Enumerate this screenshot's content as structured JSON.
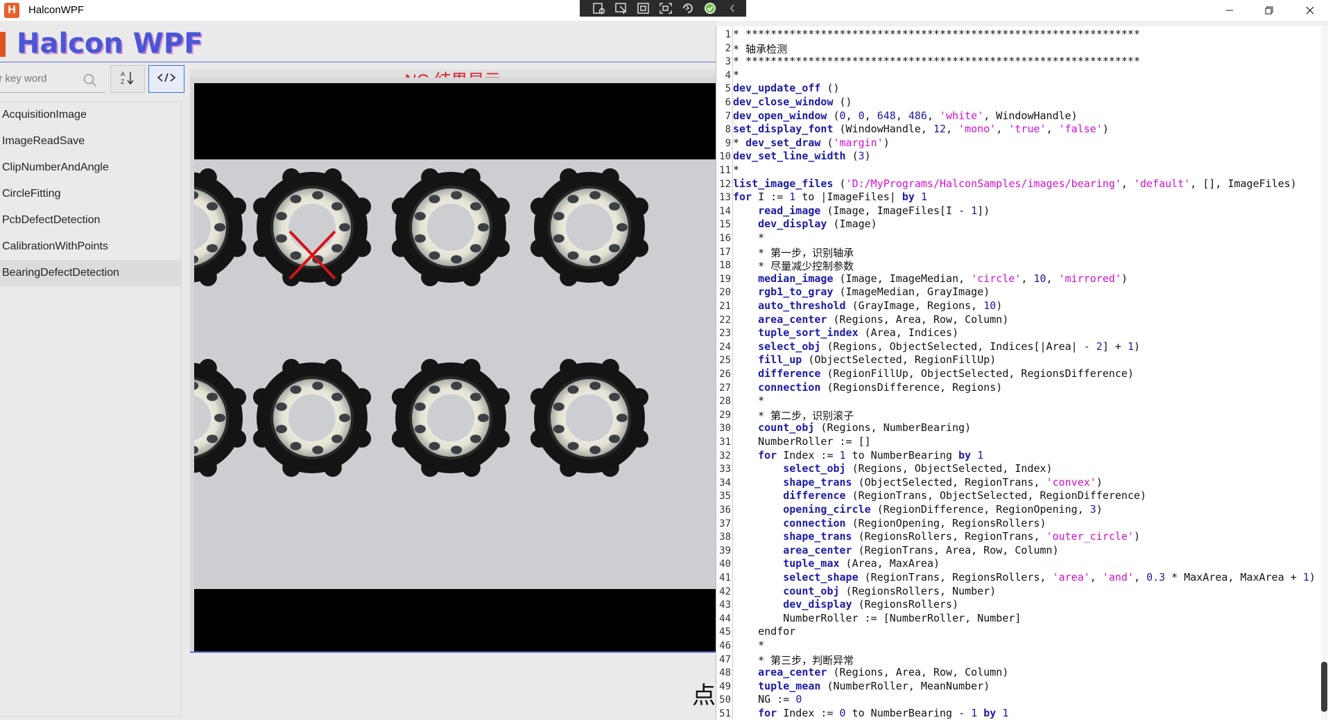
{
  "window": {
    "title": "HalconWPF",
    "app_icon_letter": "H",
    "controls": [
      "minimize-icon",
      "restore-icon",
      "close-icon"
    ]
  },
  "debug_toolbar": {
    "icons": [
      "visual-tree-icon",
      "select-element-icon",
      "display-layout-icon",
      "track-focus-icon",
      "hot-reload-icon",
      "checkmark-icon",
      "collapse-icon"
    ],
    "accent": "#6cc24a"
  },
  "header": {
    "logo": "Halcon WPF",
    "logo_color": "#4a55d6"
  },
  "search": {
    "placeholder": "er key word"
  },
  "toolbar": {
    "sort_icon": "sort-az-icon",
    "code_icon": "code-icon"
  },
  "sidebar": {
    "items": [
      {
        "label": "AcquisitionImage",
        "selected": false
      },
      {
        "label": "ImageReadSave",
        "selected": false
      },
      {
        "label": "ClipNumberAndAngle",
        "selected": false
      },
      {
        "label": "CircleFitting",
        "selected": false
      },
      {
        "label": "PcbDefectDetection",
        "selected": false
      },
      {
        "label": "CalibrationWithPoints",
        "selected": false
      },
      {
        "label": "BearingDefectDetection",
        "selected": true
      }
    ]
  },
  "result": {
    "title": "NG 结果显示",
    "title_color": "#d6202b",
    "defect_marker": "red-x-icon",
    "truncated_label": "点"
  },
  "editor": {
    "lines": [
      {
        "n": "1",
        "t": [
          [
            "* ***************************************************************",
            ""
          ]
        ]
      },
      {
        "n": "2",
        "t": [
          [
            "* 轴承检测",
            ""
          ]
        ]
      },
      {
        "n": "3",
        "t": [
          [
            "* ***************************************************************",
            ""
          ]
        ]
      },
      {
        "n": "4",
        "t": [
          [
            "*",
            ""
          ]
        ]
      },
      {
        "n": "5",
        "t": [
          [
            "dev_update_off",
            "kw"
          ],
          [
            " ()",
            ""
          ]
        ]
      },
      {
        "n": "6",
        "t": [
          [
            "dev_close_window",
            "kw"
          ],
          [
            " ()",
            ""
          ]
        ]
      },
      {
        "n": "7",
        "t": [
          [
            "dev_open_window",
            "kw"
          ],
          [
            " (",
            ""
          ],
          [
            "0",
            "num"
          ],
          [
            ", ",
            ""
          ],
          [
            "0",
            "num"
          ],
          [
            ", ",
            ""
          ],
          [
            "648",
            "num"
          ],
          [
            ", ",
            ""
          ],
          [
            "486",
            "num"
          ],
          [
            ", ",
            ""
          ],
          [
            "'white'",
            "str"
          ],
          [
            ", WindowHandle)",
            ""
          ]
        ]
      },
      {
        "n": "8",
        "t": [
          [
            "set_display_font",
            "kw"
          ],
          [
            " (WindowHandle, ",
            ""
          ],
          [
            "12",
            "num"
          ],
          [
            ", ",
            ""
          ],
          [
            "'mono'",
            "str"
          ],
          [
            ", ",
            ""
          ],
          [
            "'true'",
            "str"
          ],
          [
            ", ",
            ""
          ],
          [
            "'false'",
            "str"
          ],
          [
            ")",
            ""
          ]
        ]
      },
      {
        "n": "9",
        "t": [
          [
            "* ",
            ""
          ],
          [
            "dev_set_draw",
            "kw"
          ],
          [
            " (",
            ""
          ],
          [
            "'margin'",
            "str"
          ],
          [
            ")",
            ""
          ]
        ]
      },
      {
        "n": "10",
        "t": [
          [
            "dev_set_line_width",
            "kw"
          ],
          [
            " (",
            ""
          ],
          [
            "3",
            "num"
          ],
          [
            ")",
            ""
          ]
        ]
      },
      {
        "n": "11",
        "t": [
          [
            "*",
            ""
          ]
        ]
      },
      {
        "n": "12",
        "t": [
          [
            "list_image_files",
            "kw"
          ],
          [
            " (",
            ""
          ],
          [
            "'D:/MyPrograms/HalconSamples/images/bearing'",
            "str"
          ],
          [
            ", ",
            ""
          ],
          [
            "'default'",
            "str"
          ],
          [
            ", [], ImageFiles)",
            ""
          ]
        ]
      },
      {
        "n": "13",
        "t": [
          [
            "for",
            "ctl"
          ],
          [
            " I := ",
            ""
          ],
          [
            "1",
            "num"
          ],
          [
            " to |ImageFiles| ",
            ""
          ],
          [
            "by",
            "ctl"
          ],
          [
            " ",
            ""
          ],
          [
            "1",
            "num"
          ]
        ]
      },
      {
        "n": "14",
        "t": [
          [
            "    ",
            ""
          ],
          [
            "read_image",
            "kw"
          ],
          [
            " (Image, ImageFiles[I - ",
            ""
          ],
          [
            "1",
            "num"
          ],
          [
            "])",
            ""
          ]
        ]
      },
      {
        "n": "15",
        "t": [
          [
            "    ",
            ""
          ],
          [
            "dev_display",
            "kw"
          ],
          [
            " (Image)",
            ""
          ]
        ]
      },
      {
        "n": "16",
        "t": [
          [
            "    *",
            ""
          ]
        ]
      },
      {
        "n": "17",
        "t": [
          [
            "    * 第一步，识别轴承",
            ""
          ]
        ]
      },
      {
        "n": "18",
        "t": [
          [
            "    * 尽量减少控制参数",
            ""
          ]
        ]
      },
      {
        "n": "19",
        "t": [
          [
            "    ",
            ""
          ],
          [
            "median_image",
            "kw"
          ],
          [
            " (Image, ImageMedian, ",
            ""
          ],
          [
            "'circle'",
            "str"
          ],
          [
            ", ",
            ""
          ],
          [
            "10",
            "num"
          ],
          [
            ", ",
            ""
          ],
          [
            "'mirrored'",
            "str"
          ],
          [
            ")",
            ""
          ]
        ]
      },
      {
        "n": "20",
        "t": [
          [
            "    ",
            ""
          ],
          [
            "rgb1_to_gray",
            "kw"
          ],
          [
            " (ImageMedian, GrayImage)",
            ""
          ]
        ]
      },
      {
        "n": "21",
        "t": [
          [
            "    ",
            ""
          ],
          [
            "auto_threshold",
            "kw"
          ],
          [
            " (GrayImage, Regions, ",
            ""
          ],
          [
            "10",
            "num"
          ],
          [
            ")",
            ""
          ]
        ]
      },
      {
        "n": "22",
        "t": [
          [
            "    ",
            ""
          ],
          [
            "area_center",
            "kw"
          ],
          [
            " (Regions, Area, Row, Column)",
            ""
          ]
        ]
      },
      {
        "n": "23",
        "t": [
          [
            "    ",
            ""
          ],
          [
            "tuple_sort_index",
            "kw"
          ],
          [
            " (Area, Indices)",
            ""
          ]
        ]
      },
      {
        "n": "24",
        "t": [
          [
            "    ",
            ""
          ],
          [
            "select_obj",
            "kw"
          ],
          [
            " (Regions, ObjectSelected, Indices[|Area| - ",
            ""
          ],
          [
            "2",
            "num"
          ],
          [
            "] + ",
            ""
          ],
          [
            "1",
            "num"
          ],
          [
            ")",
            ""
          ]
        ]
      },
      {
        "n": "25",
        "t": [
          [
            "    ",
            ""
          ],
          [
            "fill_up",
            "kw"
          ],
          [
            " (ObjectSelected, RegionFillUp)",
            ""
          ]
        ]
      },
      {
        "n": "26",
        "t": [
          [
            "    ",
            ""
          ],
          [
            "difference",
            "kw"
          ],
          [
            " (RegionFillUp, ObjectSelected, RegionsDifference)",
            ""
          ]
        ]
      },
      {
        "n": "27",
        "t": [
          [
            "    ",
            ""
          ],
          [
            "connection",
            "kw"
          ],
          [
            " (RegionsDifference, Regions)",
            ""
          ]
        ]
      },
      {
        "n": "28",
        "t": [
          [
            "    *",
            ""
          ]
        ]
      },
      {
        "n": "29",
        "t": [
          [
            "    * 第二步，识别滚子",
            ""
          ]
        ]
      },
      {
        "n": "30",
        "t": [
          [
            "    ",
            ""
          ],
          [
            "count_obj",
            "kw"
          ],
          [
            " (Regions, NumberBearing)",
            ""
          ]
        ]
      },
      {
        "n": "31",
        "t": [
          [
            "    NumberRoller := []",
            ""
          ]
        ]
      },
      {
        "n": "32",
        "t": [
          [
            "    ",
            ""
          ],
          [
            "for",
            "ctl"
          ],
          [
            " Index := ",
            ""
          ],
          [
            "1",
            "num"
          ],
          [
            " to NumberBearing ",
            ""
          ],
          [
            "by",
            "ctl"
          ],
          [
            " ",
            ""
          ],
          [
            "1",
            "num"
          ]
        ]
      },
      {
        "n": "33",
        "t": [
          [
            "        ",
            ""
          ],
          [
            "select_obj",
            "kw"
          ],
          [
            " (Regions, ObjectSelected, Index)",
            ""
          ]
        ]
      },
      {
        "n": "34",
        "t": [
          [
            "        ",
            ""
          ],
          [
            "shape_trans",
            "kw"
          ],
          [
            " (ObjectSelected, RegionTrans, ",
            ""
          ],
          [
            "'convex'",
            "str"
          ],
          [
            ")",
            ""
          ]
        ]
      },
      {
        "n": "35",
        "t": [
          [
            "        ",
            ""
          ],
          [
            "difference",
            "kw"
          ],
          [
            " (RegionTrans, ObjectSelected, RegionDifference)",
            ""
          ]
        ]
      },
      {
        "n": "36",
        "t": [
          [
            "        ",
            ""
          ],
          [
            "opening_circle",
            "kw"
          ],
          [
            " (RegionDifference, RegionOpening, ",
            ""
          ],
          [
            "3",
            "num"
          ],
          [
            ")",
            ""
          ]
        ]
      },
      {
        "n": "37",
        "t": [
          [
            "        ",
            ""
          ],
          [
            "connection",
            "kw"
          ],
          [
            " (RegionOpening, RegionsRollers)",
            ""
          ]
        ]
      },
      {
        "n": "38",
        "t": [
          [
            "        ",
            ""
          ],
          [
            "shape_trans",
            "kw"
          ],
          [
            " (RegionsRollers, RegionTrans, ",
            ""
          ],
          [
            "'outer_circle'",
            "str"
          ],
          [
            ")",
            ""
          ]
        ]
      },
      {
        "n": "39",
        "t": [
          [
            "        ",
            ""
          ],
          [
            "area_center",
            "kw"
          ],
          [
            " (RegionTrans, Area, Row, Column)",
            ""
          ]
        ]
      },
      {
        "n": "40",
        "t": [
          [
            "        ",
            ""
          ],
          [
            "tuple_max",
            "kw"
          ],
          [
            " (Area, MaxArea)",
            ""
          ]
        ]
      },
      {
        "n": "41",
        "t": [
          [
            "        ",
            ""
          ],
          [
            "select_shape",
            "kw"
          ],
          [
            " (RegionTrans, RegionsRollers, ",
            ""
          ],
          [
            "'area'",
            "str"
          ],
          [
            ", ",
            ""
          ],
          [
            "'and'",
            "str"
          ],
          [
            ", ",
            ""
          ],
          [
            "0.3",
            "num"
          ],
          [
            " * MaxArea, MaxArea + ",
            ""
          ],
          [
            "1",
            "num"
          ],
          [
            ")",
            ""
          ]
        ]
      },
      {
        "n": "42",
        "t": [
          [
            "        ",
            ""
          ],
          [
            "count_obj",
            "kw"
          ],
          [
            " (RegionsRollers, Number)",
            ""
          ]
        ]
      },
      {
        "n": "43",
        "t": [
          [
            "        ",
            ""
          ],
          [
            "dev_display",
            "kw"
          ],
          [
            " (RegionsRollers)",
            ""
          ]
        ]
      },
      {
        "n": "44",
        "t": [
          [
            "        NumberRoller := [NumberRoller, Number]",
            ""
          ]
        ]
      },
      {
        "n": "45",
        "t": [
          [
            "    endfor",
            ""
          ]
        ]
      },
      {
        "n": "46",
        "t": [
          [
            "    *",
            ""
          ]
        ]
      },
      {
        "n": "47",
        "t": [
          [
            "    * 第三步，判断异常",
            ""
          ]
        ]
      },
      {
        "n": "48",
        "t": [
          [
            "    ",
            ""
          ],
          [
            "area_center",
            "kw"
          ],
          [
            " (Regions, Area, Row, Column)",
            ""
          ]
        ]
      },
      {
        "n": "49",
        "t": [
          [
            "    ",
            ""
          ],
          [
            "tuple_mean",
            "kw"
          ],
          [
            " (NumberRoller, MeanNumber)",
            ""
          ]
        ]
      },
      {
        "n": "50",
        "t": [
          [
            "    NG := ",
            ""
          ],
          [
            "0",
            "num"
          ]
        ]
      },
      {
        "n": "51",
        "t": [
          [
            "    ",
            ""
          ],
          [
            "for",
            "ctl"
          ],
          [
            " Index := ",
            ""
          ],
          [
            "0",
            "num"
          ],
          [
            " to NumberBearing - ",
            ""
          ],
          [
            "1",
            "num"
          ],
          [
            " ",
            ""
          ],
          [
            "by",
            "ctl"
          ],
          [
            " ",
            ""
          ],
          [
            "1",
            "num"
          ]
        ]
      }
    ]
  }
}
